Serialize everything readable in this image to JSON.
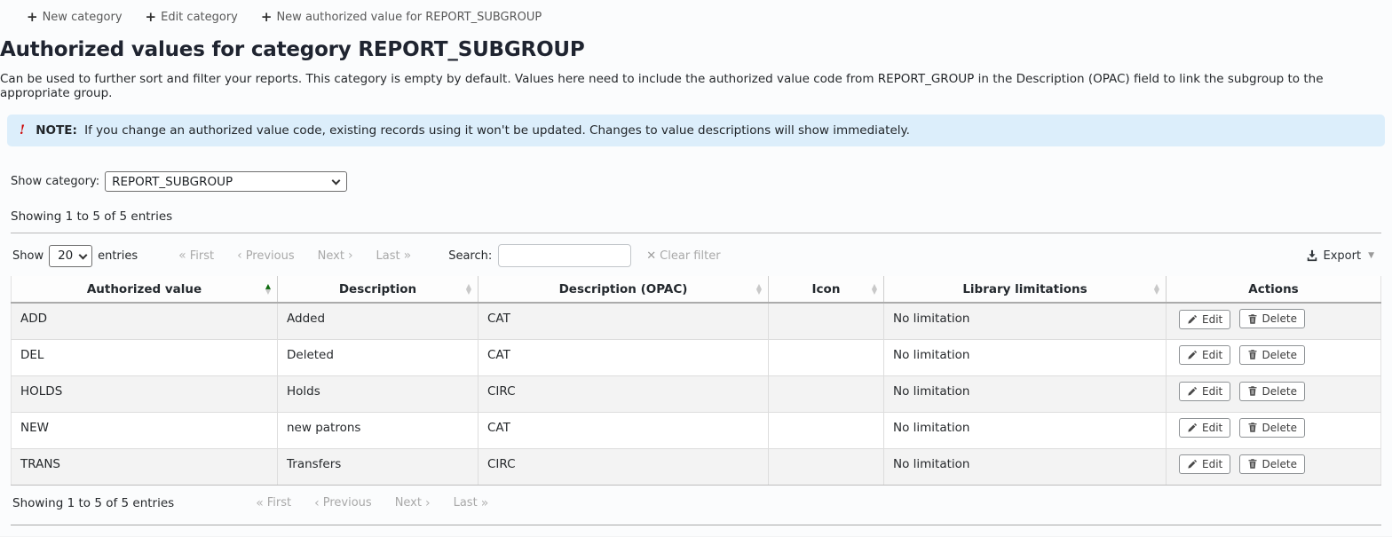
{
  "toolbar": {
    "new_category": "New category",
    "edit_category": "Edit category",
    "new_authorized_value": "New authorized value for REPORT_SUBGROUP"
  },
  "header": {
    "title": "Authorized values for category REPORT_SUBGROUP",
    "description": "Can be used to further sort and filter your reports. This category is empty by default. Values here need to include the authorized value code from REPORT_GROUP in the Description (OPAC) field to link the subgroup to the appropriate group."
  },
  "note": {
    "label": "NOTE:",
    "text": "If you change an authorized value code, existing records using it won't be updated. Changes to value descriptions will show immediately."
  },
  "filters": {
    "show_category_label": "Show category:",
    "category_selected": "REPORT_SUBGROUP",
    "showing_top": "Showing 1 to 5 of 5 entries"
  },
  "controls": {
    "show_label": "Show",
    "page_size": "20",
    "entries_label": "entries",
    "pagination": {
      "first": "First",
      "previous": "Previous",
      "next": "Next",
      "last": "Last"
    },
    "search_label": "Search:",
    "search_value": "",
    "clear_filter_label": "Clear filter",
    "export_label": "Export"
  },
  "table": {
    "columns": [
      {
        "label": "Authorized value",
        "sort": "asc"
      },
      {
        "label": "Description",
        "sort": "none"
      },
      {
        "label": "Description (OPAC)",
        "sort": "none"
      },
      {
        "label": "Icon",
        "sort": "none"
      },
      {
        "label": "Library limitations",
        "sort": "none"
      },
      {
        "label": "Actions",
        "sort": null
      }
    ],
    "rows": [
      {
        "value": "ADD",
        "description": "Added",
        "opac": "CAT",
        "icon": "",
        "limitations": "No limitation"
      },
      {
        "value": "DEL",
        "description": "Deleted",
        "opac": "CAT",
        "icon": "",
        "limitations": "No limitation"
      },
      {
        "value": "HOLDS",
        "description": "Holds",
        "opac": "CIRC",
        "icon": "",
        "limitations": "No limitation"
      },
      {
        "value": "NEW",
        "description": "new patrons",
        "opac": "CAT",
        "icon": "",
        "limitations": "No limitation"
      },
      {
        "value": "TRANS",
        "description": "Transfers",
        "opac": "CIRC",
        "icon": "",
        "limitations": "No limitation"
      }
    ],
    "edit_label": "Edit",
    "delete_label": "Delete"
  },
  "footer": {
    "showing": "Showing 1 to 5 of 5 entries"
  },
  "icons": {
    "plus": "+",
    "chevron_double_left": "«",
    "chevron_left": "‹",
    "chevron_right": "›",
    "chevron_double_right": "»",
    "clear_x": "✕",
    "caret_down": "▼",
    "sort_up": "▲",
    "sort_down": "▼",
    "exclamation": "!"
  },
  "colors": {
    "note_background": "#dceefb",
    "note_exclamation": "#cc0000",
    "sort_active": "#0d6b0d",
    "row_stripe": "#f3f3f3",
    "disabled_text": "#a9a9a9"
  }
}
